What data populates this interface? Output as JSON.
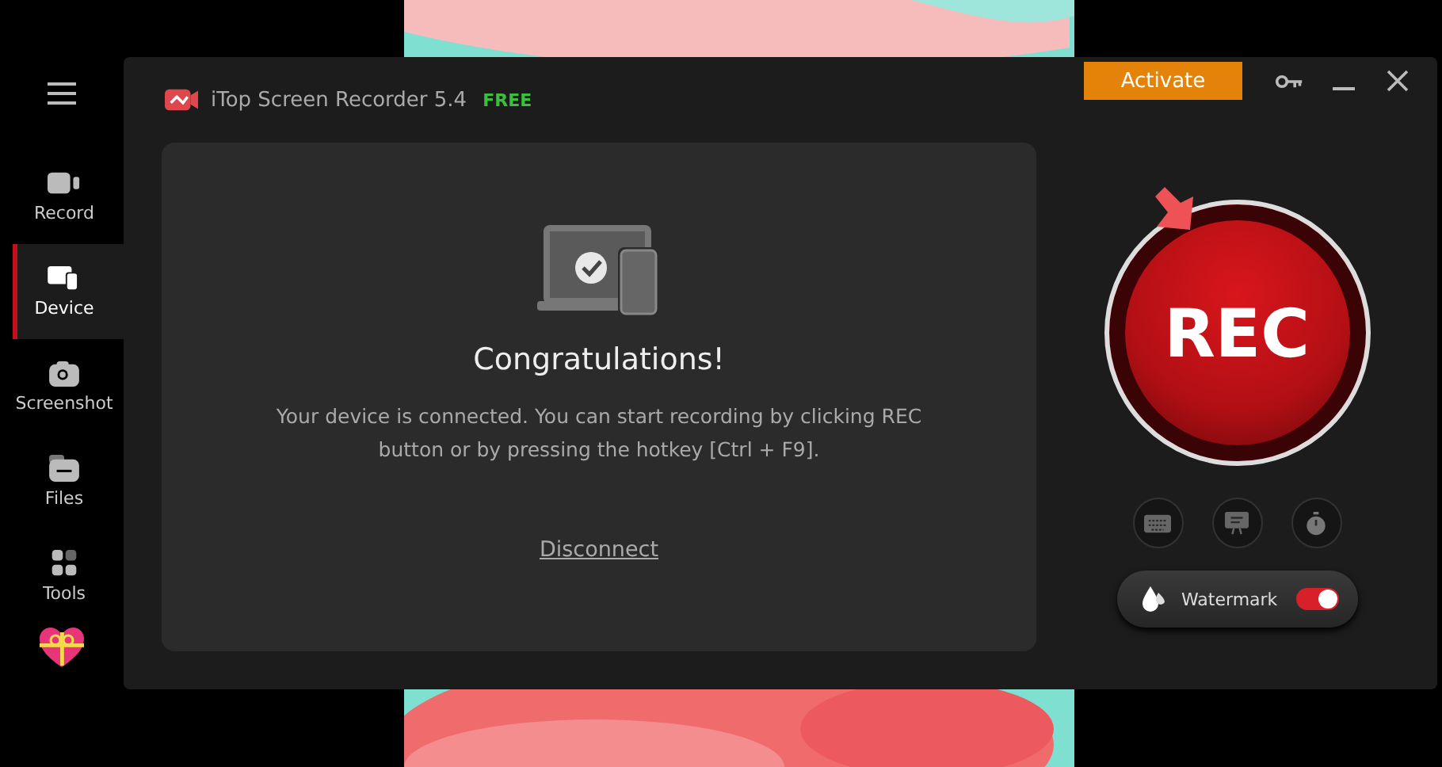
{
  "sidebar": {
    "items": [
      {
        "kind": "record",
        "label": "Record",
        "selected": false
      },
      {
        "kind": "device",
        "label": "Device",
        "selected": true
      },
      {
        "kind": "screenshot",
        "label": "Screenshot",
        "selected": false
      },
      {
        "kind": "files",
        "label": "Files",
        "selected": false
      },
      {
        "kind": "tools",
        "label": "Tools",
        "selected": false
      }
    ]
  },
  "window": {
    "title": "iTop Screen Recorder 5.4",
    "edition": "FREE",
    "activate_button": "Activate"
  },
  "device_panel": {
    "heading": "Congratulations!",
    "message": "Your device is connected. You can start recording by clicking REC button or by pressing the hotkey [Ctrl + F9].",
    "link": "Disconnect"
  },
  "record_button": "REC",
  "watermark": {
    "label": "Watermark",
    "on": true
  }
}
